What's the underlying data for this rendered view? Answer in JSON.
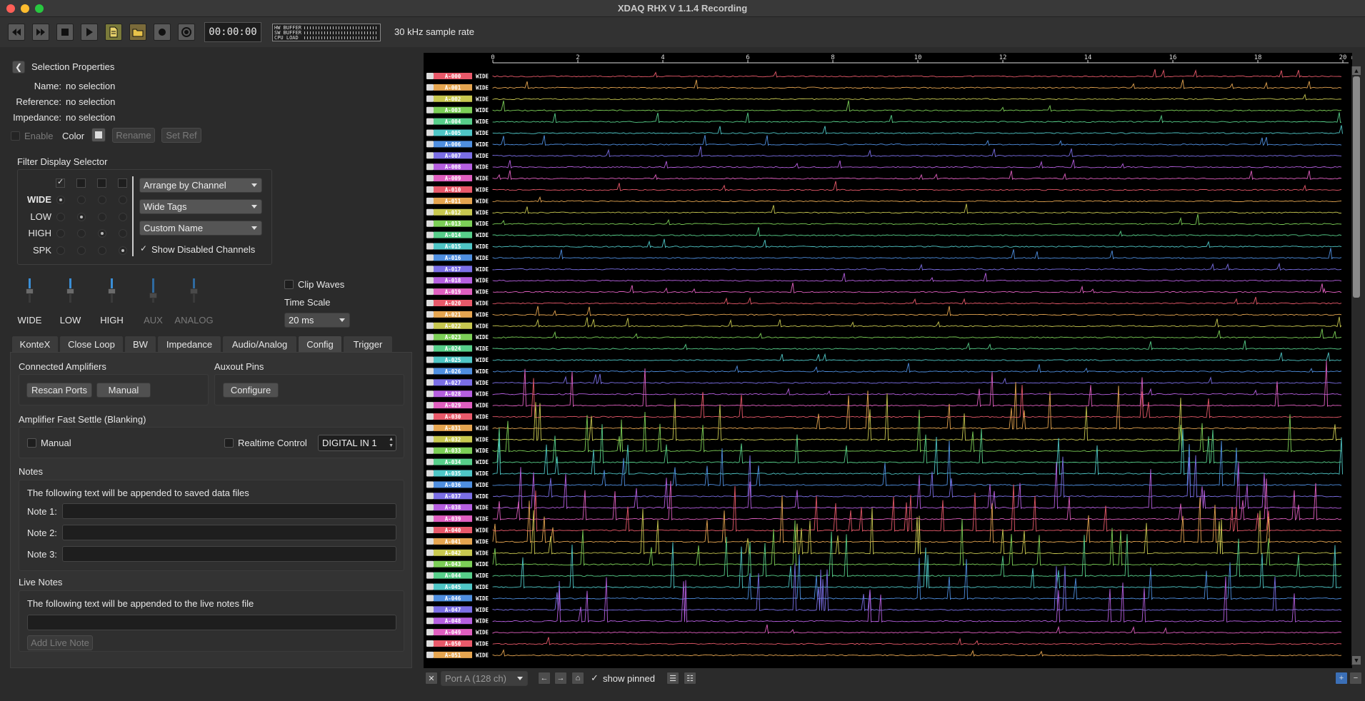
{
  "window": {
    "title": "XDAQ RHX V 1.1.4 Recording"
  },
  "toolbar": {
    "timecode": "00:00:00",
    "meters": {
      "hw_buffer": "HW BUFFER",
      "sw_buffer": "SW BUFFER",
      "cpu_load": "CPU LOAD"
    },
    "sample_rate": "30 kHz sample rate",
    "buttons": [
      "rewind-icon",
      "fast-forward-icon",
      "stop-icon",
      "play-icon",
      "save-file-icon",
      "open-folder-icon",
      "record-icon",
      "trigger-record-icon"
    ]
  },
  "selection": {
    "header": "Selection Properties",
    "name_label": "Name:",
    "name_value": "no selection",
    "reference_label": "Reference:",
    "reference_value": "no selection",
    "impedance_label": "Impedance:",
    "impedance_value": "no selection",
    "enable_label": "Enable",
    "color_label": "Color",
    "rename_label": "Rename",
    "set_ref_label": "Set Ref"
  },
  "filter_display": {
    "title": "Filter Display Selector",
    "rows": [
      "WIDE",
      "LOW",
      "HIGH",
      "SPK"
    ],
    "arrange_value": "Arrange by Channel",
    "tags_value": "Wide Tags",
    "name_value": "Custom Name",
    "show_disabled_label": "Show Disabled Channels",
    "show_disabled_checked": true
  },
  "scales": {
    "sliders": [
      {
        "label": "WIDE",
        "enabled": true,
        "level": 0.4
      },
      {
        "label": "LOW",
        "enabled": true,
        "level": 0.4
      },
      {
        "label": "HIGH",
        "enabled": true,
        "level": 0.4
      },
      {
        "label": "AUX",
        "enabled": false,
        "level": 0.6
      },
      {
        "label": "ANALOG",
        "enabled": false,
        "level": 0.4
      }
    ],
    "clip_waves_label": "Clip Waves",
    "time_scale_label": "Time Scale",
    "time_scale_value": "20 ms"
  },
  "tabs": [
    {
      "label": "KonteX",
      "active": false
    },
    {
      "label": "Close Loop",
      "active": false
    },
    {
      "label": "BW",
      "active": false
    },
    {
      "label": "Impedance",
      "active": false
    },
    {
      "label": "Audio/Analog",
      "active": false
    },
    {
      "label": "Config",
      "active": true
    },
    {
      "label": "Trigger",
      "active": false
    }
  ],
  "config": {
    "connected_amplifiers_title": "Connected Amplifiers",
    "rescan_label": "Rescan Ports",
    "manual_button_label": "Manual",
    "auxout_title": "Auxout Pins",
    "configure_label": "Configure",
    "fast_settle_title": "Amplifier Fast Settle (Blanking)",
    "manual_checkbox_label": "Manual",
    "realtime_label": "Realtime Control",
    "digital_in_value": "DIGITAL IN 1",
    "notes_title": "Notes",
    "notes_desc": "The following text will be appended to saved data files",
    "note1_label": "Note 1:",
    "note2_label": "Note 2:",
    "note3_label": "Note 3:",
    "live_notes_title": "Live Notes",
    "live_notes_desc": "The following text will be appended to the live notes file",
    "add_live_note_label": "Add Live Note"
  },
  "scope": {
    "time_ticks": [
      "0",
      "2",
      "4",
      "6",
      "8",
      "10",
      "12",
      "14",
      "16",
      "18",
      "20"
    ],
    "time_unit": "ms",
    "channel_tag": "WIDE",
    "channel_names": [
      "A-000",
      "A-001",
      "A-002",
      "A-003",
      "A-004",
      "A-005",
      "A-006",
      "A-007",
      "A-008",
      "A-009",
      "A-010",
      "A-011",
      "A-012",
      "A-013",
      "A-014",
      "A-015",
      "A-016",
      "A-017",
      "A-018",
      "A-019",
      "A-020",
      "A-021",
      "A-022",
      "A-023",
      "A-024",
      "A-025",
      "A-026",
      "A-027",
      "A-028",
      "A-029",
      "A-030",
      "A-031",
      "A-032",
      "A-033",
      "A-034",
      "A-035",
      "A-036",
      "A-037",
      "A-038",
      "A-039",
      "A-040",
      "A-041",
      "A-042",
      "A-043",
      "A-044",
      "A-045",
      "A-046",
      "A-047",
      "A-048",
      "A-049",
      "A-050",
      "A-051"
    ],
    "palette": [
      "#e8596a",
      "#e5a550",
      "#c8c850",
      "#7ccf57",
      "#57cf8a",
      "#4fc6c6",
      "#4f8fe0",
      "#7b6fe6",
      "#b65fe0",
      "#e05fc0"
    ],
    "port_value": "Port A (128 ch)",
    "show_pinned_label": "show pinned",
    "show_pinned_checked": true
  }
}
